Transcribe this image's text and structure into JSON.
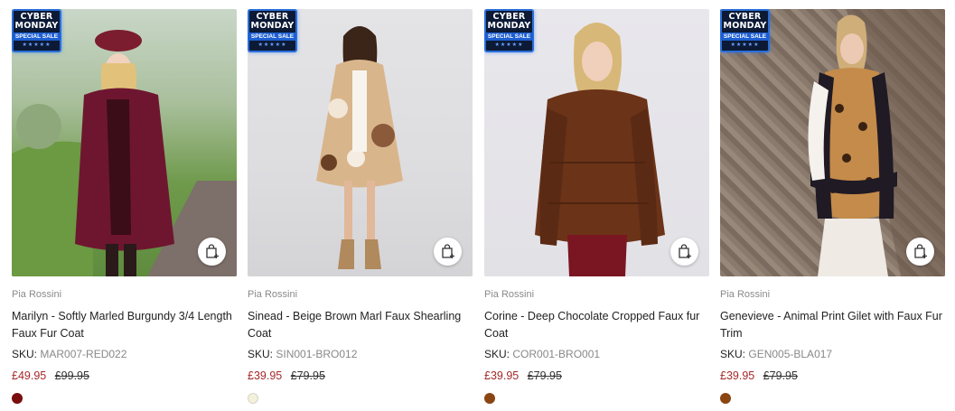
{
  "badge": {
    "line1": "CYBER",
    "line2": "MONDAY",
    "special": "SPECIAL SALE",
    "stars": "★★★★★"
  },
  "products": [
    {
      "brand": "Pia Rossini",
      "title": "Marilyn - Softly Marled Burgundy 3/4 Length Faux Fur Coat",
      "sku_label": "SKU:",
      "sku": "MAR007-RED022",
      "sale_price": "£49.95",
      "original_price": "£99.95",
      "swatch_color": "#7a0d0d",
      "image": "burgundy faux fur coat"
    },
    {
      "brand": "Pia Rossini",
      "title": "Sinead - Beige Brown Marl Faux Shearling Coat",
      "sku_label": "SKU:",
      "sku": "SIN001-BRO012",
      "sale_price": "£39.95",
      "original_price": "£79.95",
      "swatch_color": "#f3f1dc",
      "image": "beige brown shearling coat"
    },
    {
      "brand": "Pia Rossini",
      "title": "Corine - Deep Chocolate Cropped Faux fur Coat",
      "sku_label": "SKU:",
      "sku": "COR001-BRO001",
      "sale_price": "£39.95",
      "original_price": "£79.95",
      "swatch_color": "#8b4513",
      "image": "chocolate cropped fur coat"
    },
    {
      "brand": "Pia Rossini",
      "title": "Genevieve - Animal Print Gilet with Faux Fur Trim",
      "sku_label": "SKU:",
      "sku": "GEN005-BLA017",
      "sale_price": "£39.95",
      "original_price": "£79.95",
      "swatch_color": "#8b4513",
      "image": "animal print gilet"
    }
  ]
}
